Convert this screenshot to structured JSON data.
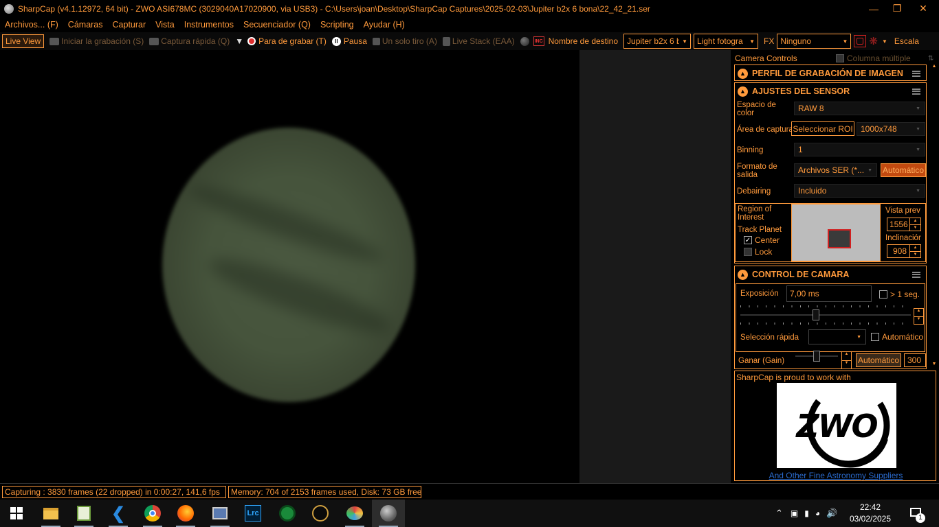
{
  "window": {
    "title": "SharpCap (v4.1.12972, 64 bit) - ZWO ASI678MC (3029040A17020900, via USB3) - C:\\Users\\joan\\Desktop\\SharpCap Captures\\2025-02-03\\Jupiter b2x 6 bona\\22_42_21.ser",
    "controls": {
      "minimize": "—",
      "maximize": "❐",
      "close": "✕"
    }
  },
  "menu": [
    "Archivos... (F)",
    "Cámaras",
    "Capturar",
    "Vista",
    "Instrumentos",
    "Secuenciador (Q)",
    "Scripting",
    "Ayudar (H)"
  ],
  "toolbar": {
    "live_view": "Live View",
    "start_recording": "Iniciar la grabación (S)",
    "quick_capture": "Captura rápida (Q)",
    "stop_recording": "Para de grabar (T)",
    "pause": "Pausa",
    "single_shot": "Un solo tiro (A)",
    "live_stack": "Live Stack (EAA)",
    "target_name_label": "Nombre de destino",
    "target_name_value": "Jupiter b2x 6 b",
    "frame_type_value": "Light fotogra",
    "fx_label": "FX",
    "fx_value": "Ninguno",
    "scale_label": "Escala",
    "inc_badge": "INC"
  },
  "panel": {
    "header": "Camera Controls",
    "multi_column": "Columna múltiple",
    "sections": {
      "recording_profile": "PERFIL DE GRABACIÓN DE IMAGEN",
      "sensor_settings": "AJUSTES DEL SENSOR",
      "camera_control": "CONTROL DE CAMARA"
    },
    "sensor": {
      "color_space_label": "Espacio de color",
      "color_space_value": "RAW 8",
      "capture_area_label": "Área de captura",
      "select_roi_button": "Seleccionar ROI",
      "capture_area_value": "1000x748",
      "binning_label": "Binning",
      "binning_value": "1",
      "output_format_label": "Formato de salida",
      "output_format_value": "Archivos SER (*...",
      "output_auto_button": "Automático",
      "debayer_label": "Debairing",
      "debayer_value": "Incluido",
      "roi_label": "Region of Interest",
      "track_planet_label": "Track Planet",
      "center_label": "Center",
      "center_checked": true,
      "lock_label": "Lock",
      "lock_checked": false,
      "preview_label": "Vista prev",
      "preview_value": "1556",
      "tilt_label": "Inclinaciór",
      "tilt_value": "908"
    },
    "camera": {
      "exposure_label": "Exposición",
      "exposure_value": "7,00 ms",
      "over_1s_label": "> 1 seg.",
      "quick_select_label": "Selección rápida",
      "auto_label": "Automático",
      "gain_label": "Ganar (Gain)",
      "gain_auto_button": "Automático",
      "gain_value": "300"
    },
    "ad": {
      "text": "SharpCap is proud to work with",
      "logo_text": "ZWO",
      "link": "And Other Fine Astronomy Suppliers"
    }
  },
  "status": {
    "capturing": "Capturing : 3830 frames (22 dropped) in 0:00:27, 141,6 fps",
    "memory": "Memory: 704 of 2153 frames used, Disk: 73 GB free"
  },
  "taskbar": {
    "apps": [
      "windows-start",
      "file-explorer",
      "notepad-plus",
      "vscode",
      "chrome",
      "firefox",
      "network-app",
      "lightroom-classic",
      "green-app",
      "stellarium",
      "paint-app",
      "sharpcap"
    ],
    "lrc_label": "Lrc",
    "time": "22:42",
    "date": "03/02/2025",
    "notification_count": "1"
  }
}
